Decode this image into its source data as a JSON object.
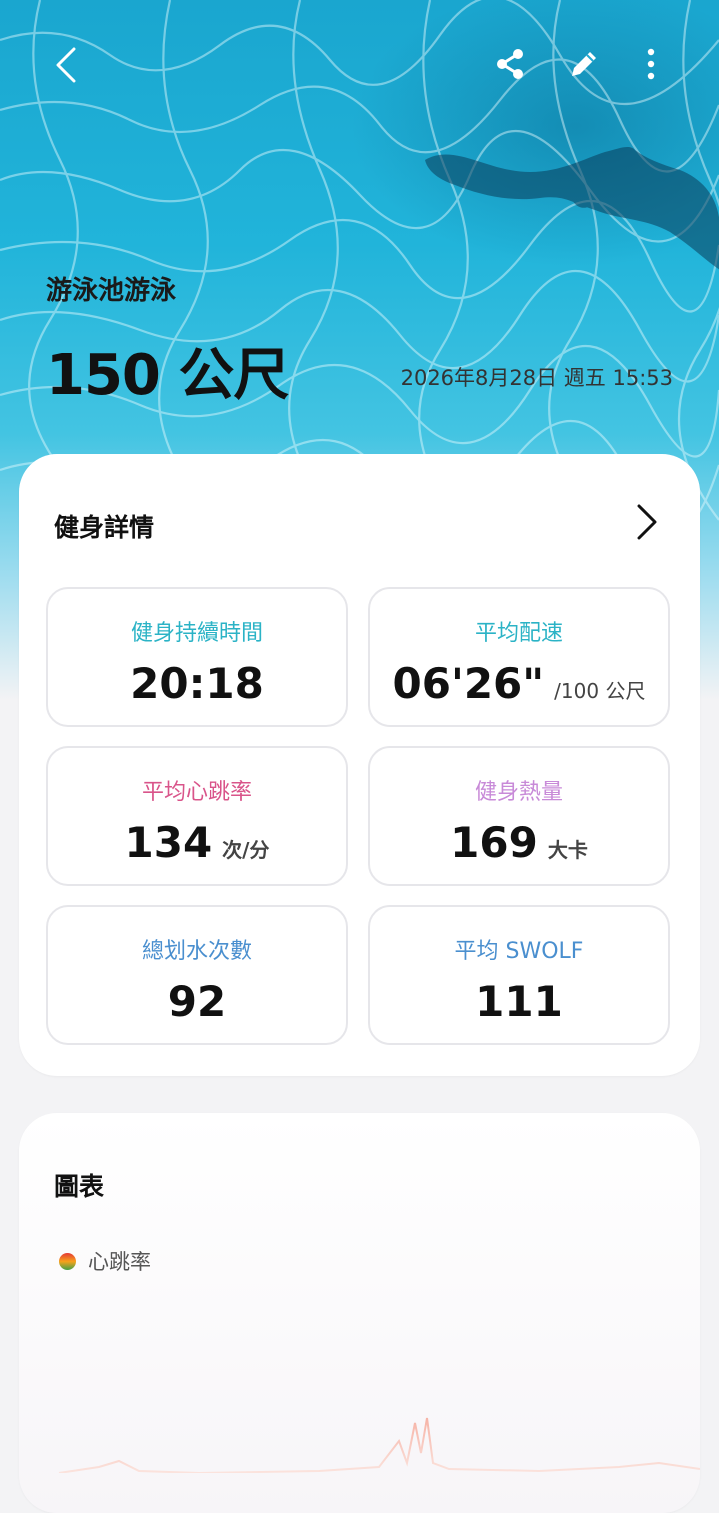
{
  "header": {
    "workout_type": "游泳池游泳",
    "distance": "150 公尺",
    "datetime": "2026年8月28日 週五 15:53"
  },
  "details": {
    "title": "健身詳情",
    "tiles": [
      {
        "label": "健身持續時間",
        "value": "20:18",
        "unit": "",
        "color": "#2bb3c6"
      },
      {
        "label": "平均配速",
        "value": "06'26\"",
        "unit": "/100 公尺",
        "color": "#2bb3c6"
      },
      {
        "label": "平均心跳率",
        "value": "134",
        "unit": "次/分",
        "color": "#d9548a"
      },
      {
        "label": "健身熱量",
        "value": "169",
        "unit": "大卡",
        "color": "#c88ad8"
      },
      {
        "label": "總划水次數",
        "value": "92",
        "unit": "",
        "color": "#4a8fcf"
      },
      {
        "label": "平均 SWOLF",
        "value": "111",
        "unit": "",
        "color": "#4a8fcf"
      }
    ]
  },
  "chart_section": {
    "title": "圖表",
    "legend": "心跳率"
  },
  "icons": {
    "back": "back-arrow-icon",
    "share": "share-icon",
    "edit": "pencil-icon",
    "more": "more-vertical-icon",
    "chevron": "chevron-right-icon",
    "legend_dot": "heart-rate-legend-dot"
  }
}
